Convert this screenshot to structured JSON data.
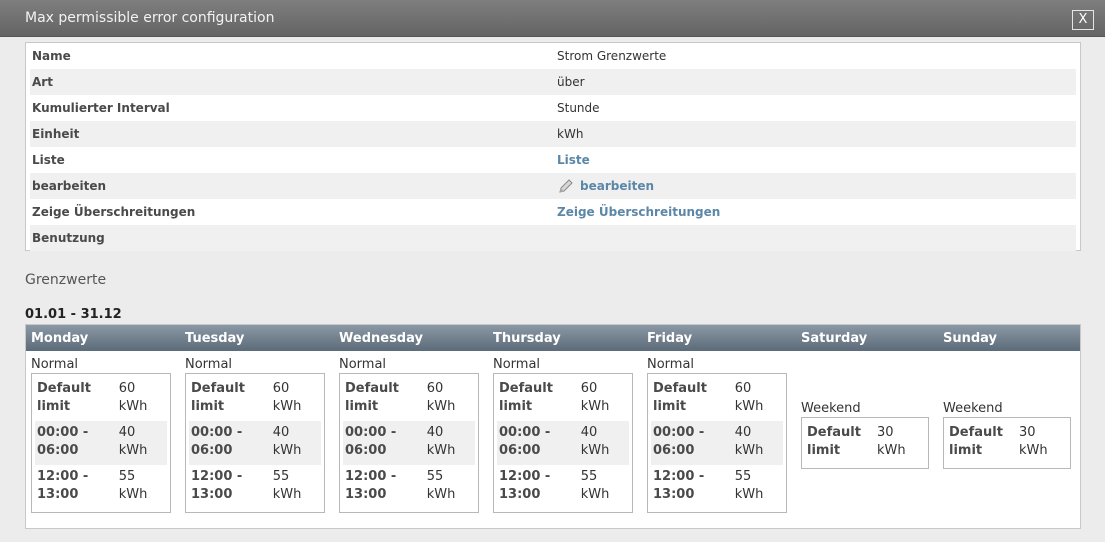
{
  "dialog": {
    "title": "Max permissible error configuration",
    "close_label": "X"
  },
  "properties": [
    {
      "label": "Name",
      "value": "Strom Grenzwerte",
      "link": false
    },
    {
      "label": "Art",
      "value": "über",
      "link": false
    },
    {
      "label": "Kumulierter Interval",
      "value": "Stunde",
      "link": false
    },
    {
      "label": "Einheit",
      "value": "kWh",
      "link": false
    },
    {
      "label": "Liste",
      "value": "Liste",
      "link": true
    },
    {
      "label": "bearbeiten",
      "value": "bearbeiten",
      "link": true,
      "icon": "pencil-icon"
    },
    {
      "label": "Zeige Überschreitungen",
      "value": "Zeige Überschreitungen",
      "link": true
    },
    {
      "label": "Benutzung",
      "value": "",
      "link": false
    }
  ],
  "limits_section": {
    "title": "Grenzwerte",
    "date_range": "01.01 - 31.12"
  },
  "days": [
    {
      "name": "Monday",
      "type": "Normal",
      "rows": [
        {
          "label": "Default limit",
          "value": "60 kWh"
        },
        {
          "label": "00:00 - 06:00",
          "value": "40 kWh"
        },
        {
          "label": "12:00 - 13:00",
          "value": "55 kWh"
        }
      ]
    },
    {
      "name": "Tuesday",
      "type": "Normal",
      "rows": [
        {
          "label": "Default limit",
          "value": "60 kWh"
        },
        {
          "label": "00:00 - 06:00",
          "value": "40 kWh"
        },
        {
          "label": "12:00 - 13:00",
          "value": "55 kWh"
        }
      ]
    },
    {
      "name": "Wednesday",
      "type": "Normal",
      "rows": [
        {
          "label": "Default limit",
          "value": "60 kWh"
        },
        {
          "label": "00:00 - 06:00",
          "value": "40 kWh"
        },
        {
          "label": "12:00 - 13:00",
          "value": "55 kWh"
        }
      ]
    },
    {
      "name": "Thursday",
      "type": "Normal",
      "rows": [
        {
          "label": "Default limit",
          "value": "60 kWh"
        },
        {
          "label": "00:00 - 06:00",
          "value": "40 kWh"
        },
        {
          "label": "12:00 - 13:00",
          "value": "55 kWh"
        }
      ]
    },
    {
      "name": "Friday",
      "type": "Normal",
      "rows": [
        {
          "label": "Default limit",
          "value": "60 kWh"
        },
        {
          "label": "00:00 - 06:00",
          "value": "40 kWh"
        },
        {
          "label": "12:00 - 13:00",
          "value": "55 kWh"
        }
      ]
    },
    {
      "name": "Saturday",
      "type": "Weekend",
      "rows": [
        {
          "label": "Default limit",
          "value": "30 kWh"
        }
      ]
    },
    {
      "name": "Sunday",
      "type": "Weekend",
      "rows": [
        {
          "label": "Default limit",
          "value": "30 kWh"
        }
      ]
    }
  ],
  "colors": {
    "link": "#5b87a8",
    "header_top": "#8b98a5",
    "header_bottom": "#5c6b79",
    "titlebar": "#6e6e6e"
  }
}
